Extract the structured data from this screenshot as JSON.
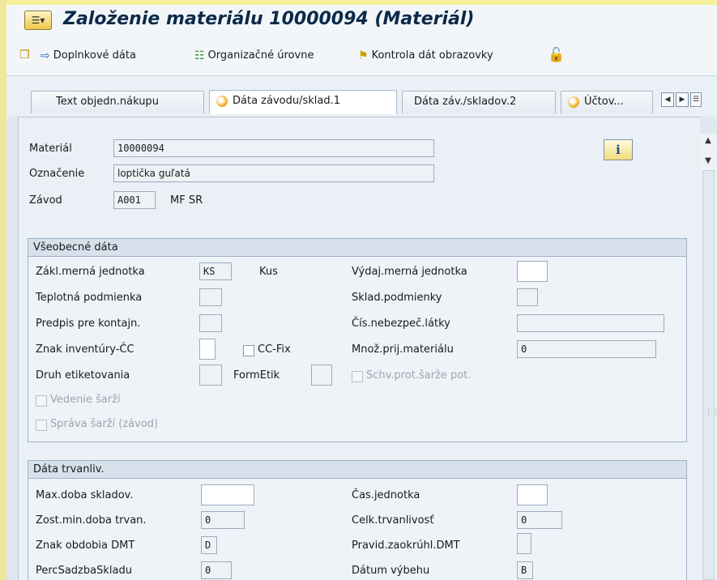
{
  "window": {
    "title": "Založenie materiálu 10000094 (Materiál)"
  },
  "toolbar": {
    "additional_data": "Doplnkové dáta",
    "org_levels": "Organizačné úrovne",
    "check_screen_data": "Kontrola dát obrazovky"
  },
  "tabs": [
    {
      "label": "Text objedn.nákupu"
    },
    {
      "label": "Dáta závodu/sklad.1"
    },
    {
      "label": "Dáta záv./skladov.2"
    },
    {
      "label": "Účtov..."
    }
  ],
  "header": {
    "material_label": "Materiál",
    "material_value": "10000094",
    "description_label": "Označenie",
    "description_value": "loptička guľatá",
    "plant_label": "Závod",
    "plant_value": "A001",
    "plant_name": "MF SR"
  },
  "general": {
    "title": "Všeobecné dáta",
    "base_uom_label": "Zákl.merná jednotka",
    "base_uom_value": "KS",
    "base_uom_text": "Kus",
    "issue_uom_label": "Výdaj.merná jednotka",
    "issue_uom_value": "",
    "temp_cond_label": "Teplotná podmienka",
    "temp_cond_value": "",
    "storage_cond_label": "Sklad.podmienky",
    "storage_cond_value": "",
    "container_label": "Predpis pre kontajn.",
    "container_value": "",
    "hazmat_label": "Čís.nebezpeč.látky",
    "hazmat_value": "",
    "cycle_count_label": "Znak inventúry-ČC",
    "cycle_count_value": "",
    "cc_fix_label": "CC-Fix",
    "gr_qty_label": "Množ.prij.materiálu",
    "gr_qty_value": "0",
    "label_type_label": "Druh etiketovania",
    "label_type_value": "",
    "form_label": "FormEtik",
    "form_value": "",
    "batch_appr_label": "Schv.prot.šarže pot.",
    "batch_mgmt_label": "Vedenie šarží",
    "batch_plant_label": "Správa šarží (závod)"
  },
  "shelf": {
    "title": "Dáta trvanliv.",
    "max_storage_label": "Max.doba skladov.",
    "max_storage_value": "",
    "time_unit_label": "Čas.jednotka",
    "time_unit_value": "",
    "min_rem_label": "Zost.min.doba trvan.",
    "min_rem_value": "0",
    "total_shelf_label": "Celk.trvanlivosť",
    "total_shelf_value": "0",
    "period_ind_label": "Znak obdobia DMT",
    "period_ind_value": "D",
    "rounding_label": "Pravid.zaokrúhl.DMT",
    "rounding_value": "",
    "storage_pct_label": "PercSadzbaSkladu",
    "storage_pct_value": "0",
    "expiry_label": "Dátum výbehu",
    "expiry_value": "B"
  }
}
